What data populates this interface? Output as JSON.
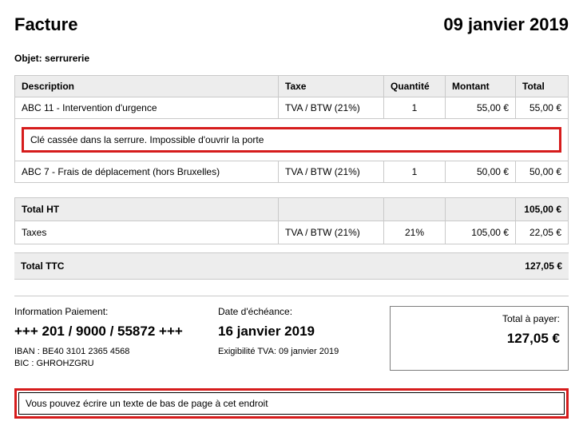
{
  "header": {
    "title": "Facture",
    "date": "09 janvier 2019"
  },
  "subject_label": "Objet:",
  "subject_value": "serrurerie",
  "columns": {
    "description": "Description",
    "tax": "Taxe",
    "qty": "Quantité",
    "amount": "Montant",
    "total": "Total"
  },
  "lines": [
    {
      "desc": "ABC 11 - Intervention d'urgence",
      "tax": "TVA / BTW (21%)",
      "qty": "1",
      "amount": "55,00 €",
      "total": "55,00 €"
    },
    {
      "desc": "ABC 7 - Frais de déplacement (hors Bruxelles)",
      "tax": "TVA / BTW (21%)",
      "qty": "1",
      "amount": "50,00 €",
      "total": "50,00 €"
    }
  ],
  "note": "Clé cassée dans la serrure. Impossible d'ouvrir la porte",
  "totals": {
    "ht_label": "Total HT",
    "ht_value": "105,00 €",
    "taxes_label": "Taxes",
    "taxes_tax": "TVA / BTW (21%)",
    "taxes_rate": "21%",
    "taxes_base": "105,00 €",
    "taxes_amount": "22,05 €",
    "ttc_label": "Total TTC",
    "ttc_value": "127,05 €"
  },
  "payment": {
    "info_label": "Information Paiement:",
    "structured": "+++ 201 / 9000 / 55872 +++",
    "iban": "IBAN : BE40 3101 2365 4568",
    "bic": "BIC : GHROHZGRU",
    "due_label": "Date d'échéance:",
    "due_date": "16 janvier 2019",
    "vat_due": "Exigibilité TVA: 09 janvier 2019",
    "to_pay_label": "Total à payer:",
    "to_pay_value": "127,05 €"
  },
  "footer": "Vous pouvez écrire un texte de bas de page à cet endroit"
}
